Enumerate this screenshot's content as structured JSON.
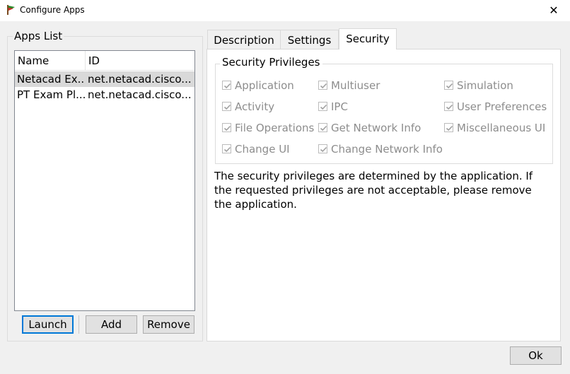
{
  "window": {
    "title": "Configure Apps",
    "close_glyph": "✕"
  },
  "apps_list": {
    "legend": "Apps List",
    "columns": [
      "Name",
      "ID"
    ],
    "rows": [
      {
        "name": "Netacad Ex...",
        "id": "net.netacad.cisco....",
        "selected": true
      },
      {
        "name": "PT Exam Pl...",
        "id": "net.netacad.cisco....",
        "selected": false
      }
    ],
    "buttons": {
      "launch": "Launch",
      "add": "Add",
      "remove": "Remove"
    }
  },
  "tabs": [
    "Description",
    "Settings",
    "Security"
  ],
  "active_tab": "Security",
  "security": {
    "legend": "Security Privileges",
    "privileges": [
      [
        "Application",
        "Multiuser",
        "Simulation"
      ],
      [
        "Activity",
        "IPC",
        "User Preferences"
      ],
      [
        "File Operations",
        "Get Network Info",
        "Miscellaneous UI"
      ],
      [
        "Change UI",
        "Change Network Info"
      ]
    ],
    "description": "The security privileges are determined by the application. If the requested privileges are not acceptable, please remove the application."
  },
  "ok_button": "Ok",
  "colors": {
    "accent": "#0078d7",
    "disabled_text": "#8d8d8d",
    "selected_row": "#d9d9d9"
  }
}
